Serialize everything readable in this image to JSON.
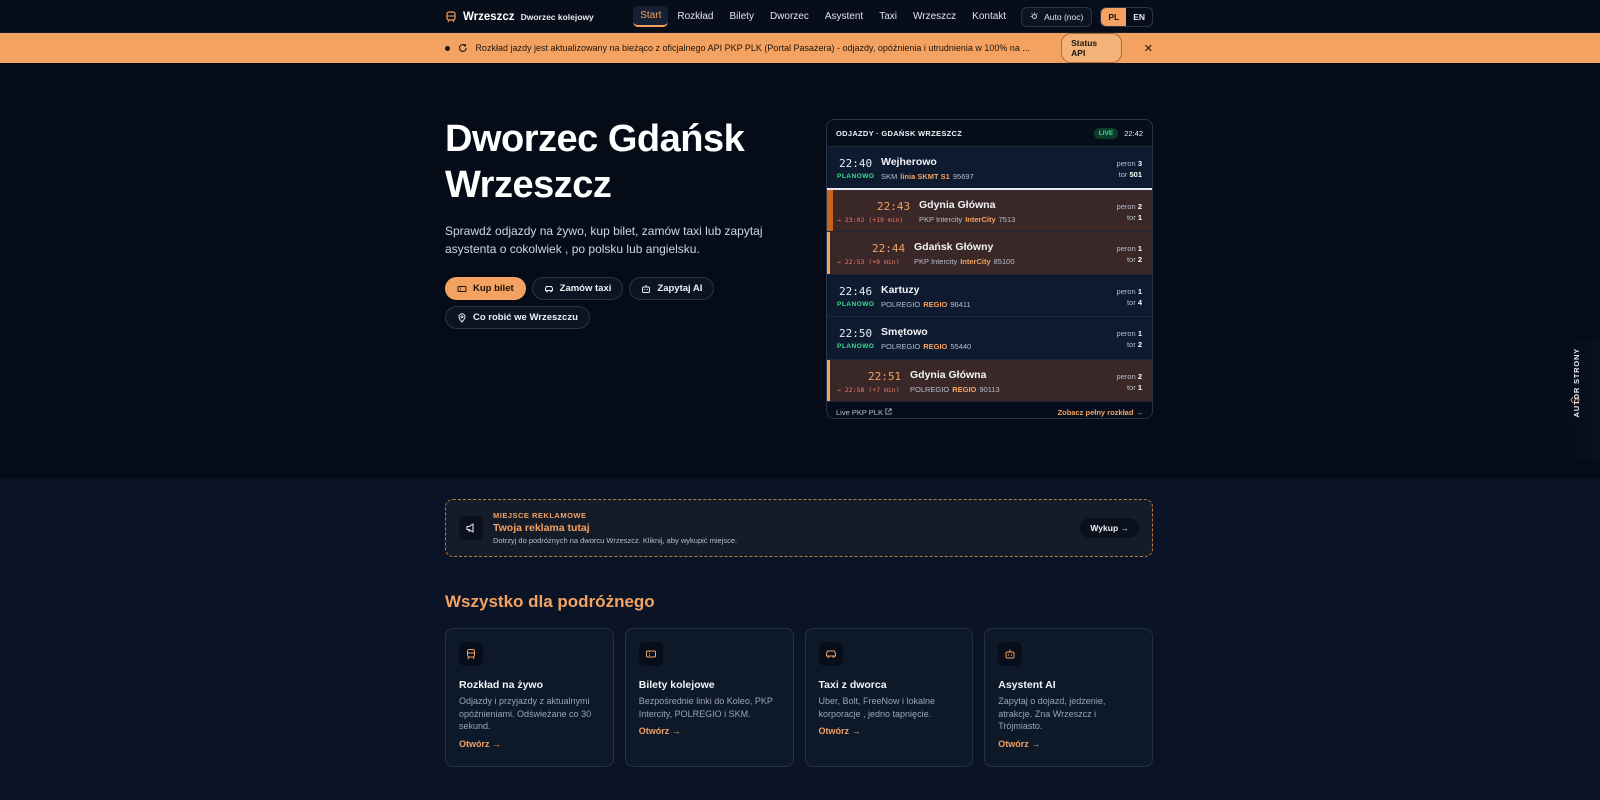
{
  "nav": {
    "brand_name": "Wrzeszcz",
    "brand_sub": "Dworzec kolejowy",
    "links": [
      "Start",
      "Rozkład",
      "Bilety",
      "Dworzec",
      "Asystent",
      "Taxi",
      "Wrzeszcz",
      "Kontakt"
    ],
    "theme_label": "Auto (noc)",
    "lang_pl": "PL",
    "lang_en": "EN"
  },
  "banner": {
    "text": "Rozkład jazdy jest aktualizowany na bieżąco z oficjalnego API PKP PLK (Portal Pasażera) - odjazdy, opóźnienia i utrudnienia w 100% na ...",
    "status_button": "Status API",
    "close": "✕"
  },
  "hero": {
    "title": "Dworzec Gdańsk Wrzeszcz",
    "description": "Sprawdź odjazdy na żywo, kup bilet, zamów taxi lub zapytaj asystenta o cokolwiek , po polsku lub angielsku.",
    "buttons": [
      "Kup bilet",
      "Zamów taxi",
      "Zapytaj AI",
      "Co robić we Wrzeszczu"
    ]
  },
  "board": {
    "title": "ODJAZDY · GDAŃSK WRZESZCZ",
    "live": "LIVE",
    "clock": "22:42",
    "platform_label": "peron",
    "track_label": "tor",
    "rows": [
      {
        "time": "22:40",
        "sub": "PLANOWO",
        "dest": "Wejherowo",
        "carrier": "SKM",
        "cat": "linia SKMT S1",
        "num": "95697",
        "platform": "3",
        "track": "501",
        "delayed": false
      },
      {
        "time": "22:43",
        "sub": "→ 23:02 (+19 min)",
        "dest": "Gdynia Główna",
        "carrier": "PKP Intercity",
        "cat": "InterCity",
        "num": "7513",
        "platform": "2",
        "track": "1",
        "delayed": true
      },
      {
        "time": "22:44",
        "sub": "→ 22:53 (+9 min)",
        "dest": "Gdańsk Główny",
        "carrier": "PKP Intercity",
        "cat": "InterCity",
        "num": "85100",
        "platform": "1",
        "track": "2",
        "delayed": true
      },
      {
        "time": "22:46",
        "sub": "PLANOWO",
        "dest": "Kartuzy",
        "carrier": "POLREGIO",
        "cat": "REGIO",
        "num": "96411",
        "platform": "1",
        "track": "4",
        "delayed": false
      },
      {
        "time": "22:50",
        "sub": "PLANOWO",
        "dest": "Smętowo",
        "carrier": "POLREGIO",
        "cat": "REGIO",
        "num": "55440",
        "platform": "1",
        "track": "2",
        "delayed": false
      },
      {
        "time": "22:51",
        "sub": "→ 22:58 (+7 min)",
        "dest": "Gdynia Główna",
        "carrier": "POLREGIO",
        "cat": "REGIO",
        "num": "90113",
        "platform": "2",
        "track": "1",
        "delayed": true
      }
    ],
    "footer_left": "Live PKP PLK",
    "footer_right": "Zobacz pełny rozkład →"
  },
  "author_tab": "AUTOR STRONY",
  "ad": {
    "label": "MIEJSCE REKLAMOWE",
    "title": "Twoja reklama tutaj",
    "desc": "Dotrzyj do podróżnych na dworcu Wrzeszcz. Kliknij, aby wykupić miejsce.",
    "button": "Wykup →"
  },
  "features": {
    "title": "Wszystko dla podróżnego",
    "cards": [
      {
        "icon": "train-icon",
        "title": "Rozkład na żywo",
        "desc": "Odjazdy i przyjazdy z aktualnymi opóźnieniami. Odświeżane co 30 sekund.",
        "link": "Otwórz →"
      },
      {
        "icon": "ticket-icon",
        "title": "Bilety kolejowe",
        "desc": "Bezpośrednie linki do Koleo, PKP Intercity, POLREGIO i SKM.",
        "link": "Otwórz →"
      },
      {
        "icon": "car-icon",
        "title": "Taxi z dworca",
        "desc": "Uber, Bolt, FreeNow i lokalne korporacje , jedno tapnięcie.",
        "link": "Otwórz →"
      },
      {
        "icon": "robot-icon",
        "title": "Asystent AI",
        "desc": "Zapytaj o dojazd, jedzenie, atrakcje. Zna Wrzeszcz i Trójmiasto.",
        "link": "Otwórz →"
      }
    ]
  },
  "colors": {
    "accent": "#f4a261",
    "bg": "#060c18",
    "live": "#3ddc97",
    "late": "#f07a6a"
  }
}
